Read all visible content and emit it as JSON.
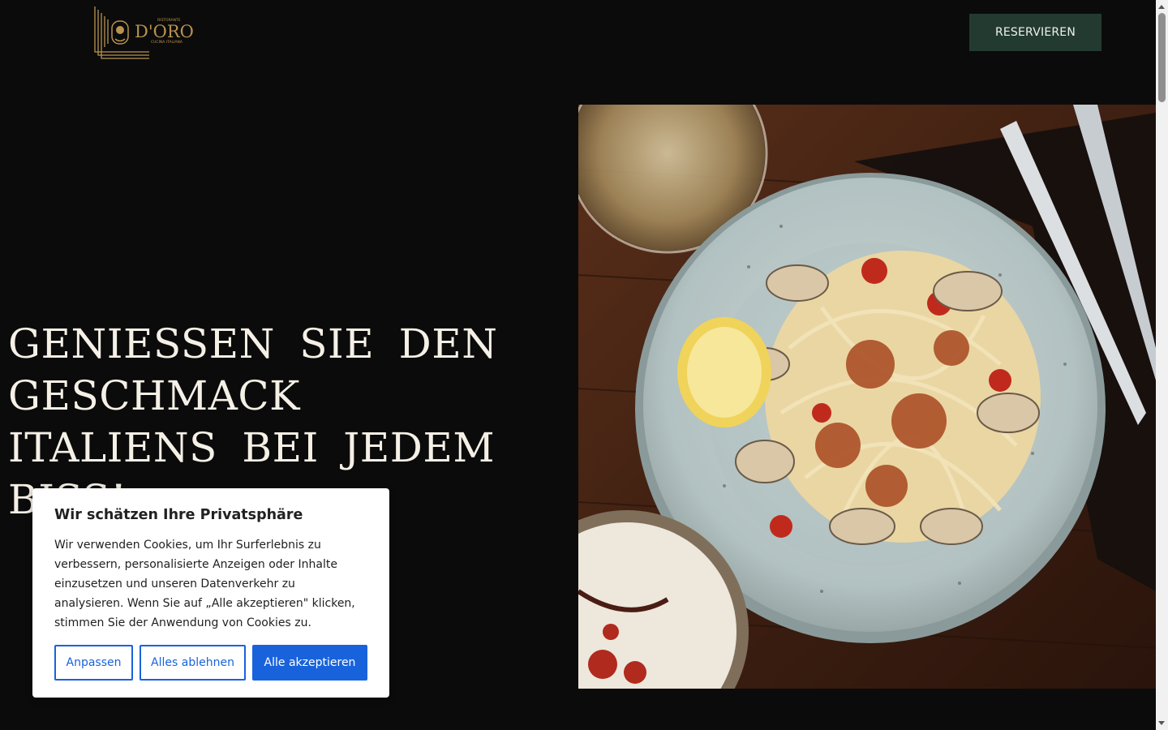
{
  "header": {
    "logo": {
      "brand": "D'ORO",
      "tagline_top": "RISTORANTE",
      "tagline_bottom": "CUCINA ITALIANA"
    },
    "reserve_button": "RESERVIEREN"
  },
  "hero": {
    "title": "GENIESSEN SIE DEN GESCHMACK ITALIENS BEI JEDEM BISS!",
    "image_subject": "spaghetti-clams-dish-image"
  },
  "cookie_banner": {
    "title": "Wir schätzen Ihre Privatsphäre",
    "text": "Wir verwenden Cookies, um Ihr Surferlebnis zu verbessern, personalisierte Anzeigen oder Inhalte einzusetzen und unseren Datenverkehr zu analysieren. Wenn Sie auf „Alle akzeptieren\" klicken, stimmen Sie der Anwendung von Cookies zu.",
    "buttons": {
      "customize": "Anpassen",
      "reject": "Alles ablehnen",
      "accept": "Alle akzeptieren"
    }
  },
  "colors": {
    "page_background": "#0b0b0b",
    "logo_gold": "#b8924f",
    "reserve_button_bg": "#233a30",
    "cookie_accent": "#1863dc"
  }
}
